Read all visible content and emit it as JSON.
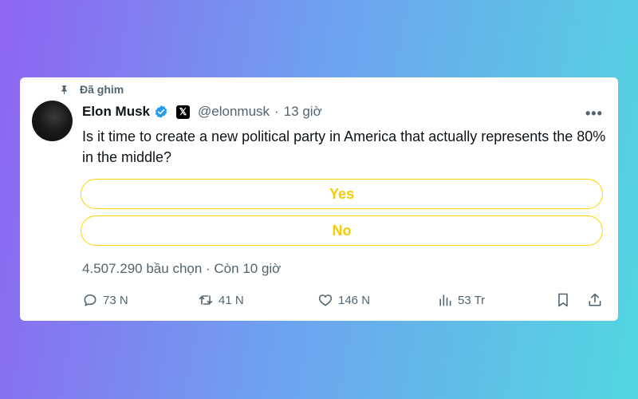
{
  "pinned_label": "Đã ghim",
  "author": {
    "name": "Elon Musk",
    "handle": "@elonmusk",
    "time": "13 giờ",
    "separator": "·"
  },
  "tweet_text": "Is it time to create a new political party in America that actually represents the 80% in the middle?",
  "poll": {
    "options": [
      "Yes",
      "No"
    ],
    "votes": "4.507.290 bầu chọn · Còn 10 giờ"
  },
  "actions": {
    "replies": "73 N",
    "retweets": "41 N",
    "likes": "146 N",
    "views": "53 Tr"
  },
  "colors": {
    "poll_accent": "#ffd400",
    "verified": "#1d9bf0",
    "secondary_text": "#536471"
  },
  "icons": {
    "pin": "pin-icon",
    "verified": "verified-badge-icon",
    "x_logo": "x-logo-icon",
    "more": "more-icon",
    "reply": "reply-icon",
    "retweet": "retweet-icon",
    "like": "like-icon",
    "views": "views-icon",
    "bookmark": "bookmark-icon",
    "share": "share-icon"
  }
}
